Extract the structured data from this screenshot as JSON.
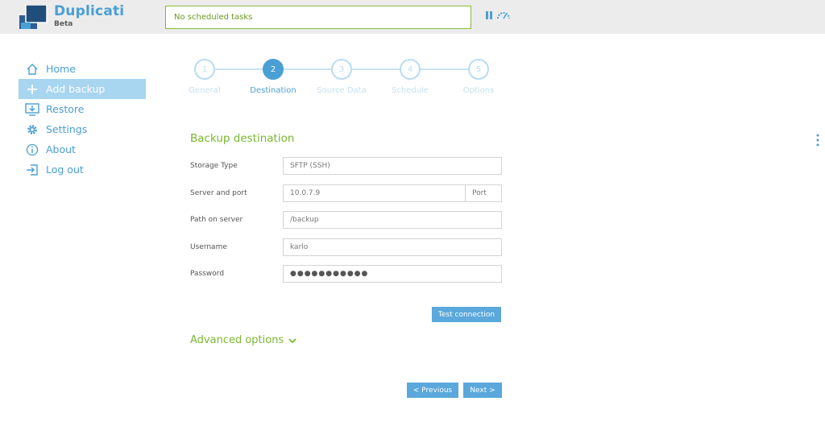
{
  "app": {
    "name": "Duplicati",
    "edition": "Beta"
  },
  "header": {
    "status_text": "No scheduled tasks"
  },
  "sidebar": {
    "items": [
      {
        "label": "Home",
        "icon": "home-icon"
      },
      {
        "label": "Add backup",
        "icon": "plus-icon",
        "active": true
      },
      {
        "label": "Restore",
        "icon": "restore-icon"
      },
      {
        "label": "Settings",
        "icon": "gear-icon"
      },
      {
        "label": "About",
        "icon": "info-icon"
      },
      {
        "label": "Log out",
        "icon": "logout-icon"
      }
    ]
  },
  "wizard": {
    "current_step": 2,
    "steps": [
      {
        "number": "1",
        "label": "General"
      },
      {
        "number": "2",
        "label": "Destination"
      },
      {
        "number": "3",
        "label": "Source Data"
      },
      {
        "number": "4",
        "label": "Schedule"
      },
      {
        "number": "5",
        "label": "Options"
      }
    ]
  },
  "form": {
    "title": "Backup destination",
    "storage_type": {
      "label": "Storage Type",
      "value": "SFTP (SSH)"
    },
    "server": {
      "label": "Server and port",
      "value": "10.0.7.9",
      "port_placeholder": "Port"
    },
    "path": {
      "label": "Path on server",
      "value": "/backup"
    },
    "username": {
      "label": "Username",
      "value": "karlo"
    },
    "password": {
      "label": "Password",
      "value": "●●●●●●●●●●●"
    },
    "test_connection": "Test connection",
    "advanced_options": "Advanced options"
  },
  "nav_buttons": {
    "previous": "< Previous",
    "next": "Next >"
  },
  "colors": {
    "accent_blue": "#4a9fd5",
    "accent_green": "#7ab831",
    "active_nav_bg": "#a8d5f0",
    "header_bg": "#ececec"
  }
}
